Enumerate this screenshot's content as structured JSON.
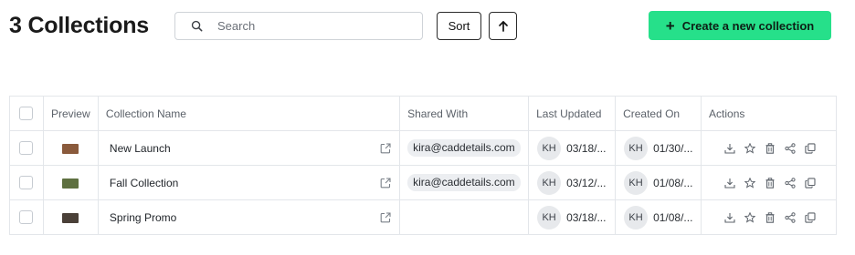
{
  "header": {
    "title": "3 Collections",
    "search_placeholder": "Search",
    "sort_label": "Sort",
    "create_label": "Create a new collection",
    "create_color": "#26e08a"
  },
  "table": {
    "columns": [
      "Preview",
      "Collection Name",
      "Shared With",
      "Last Updated",
      "Created On",
      "Actions"
    ],
    "rows": [
      {
        "name": "New Launch",
        "shared": "kira@caddetails.com",
        "updated_initials": "KH",
        "updated": "03/18/...",
        "created_initials": "KH",
        "created": "01/30/...",
        "thumb_color": "#8a5a3c"
      },
      {
        "name": "Fall Collection",
        "shared": "kira@caddetails.com",
        "updated_initials": "KH",
        "updated": "03/12/...",
        "created_initials": "KH",
        "created": "01/08/...",
        "thumb_color": "#5e7040"
      },
      {
        "name": "Spring Promo",
        "shared": "",
        "updated_initials": "KH",
        "updated": "03/18/...",
        "created_initials": "KH",
        "created": "01/08/...",
        "thumb_color": "#4a4038"
      }
    ],
    "action_icons": [
      "download-icon",
      "star-icon",
      "trash-icon",
      "share-icon",
      "duplicate-icon"
    ]
  }
}
